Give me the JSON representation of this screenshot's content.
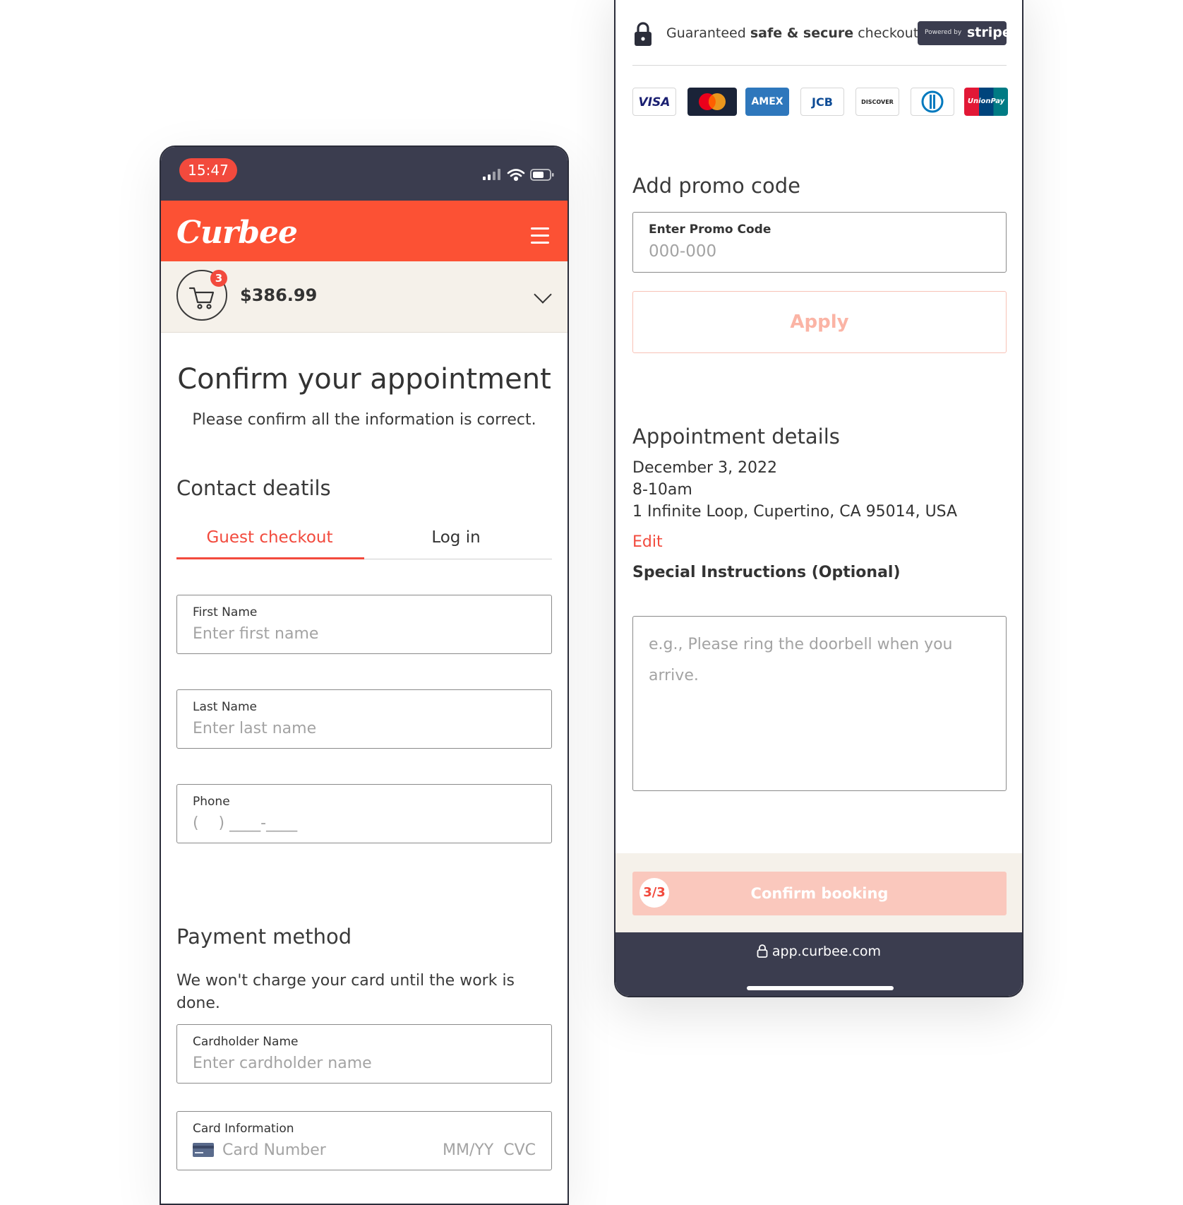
{
  "left_phone": {
    "status_time": "15:47",
    "brand": "Curbee",
    "cart": {
      "count": "3",
      "total": "$386.99"
    },
    "page_title": "Confirm your appointment",
    "page_subtitle": "Please confirm all the information is correct.",
    "contact_heading": "Contact deatils",
    "tabs": [
      {
        "label": "Guest checkout"
      },
      {
        "label": "Log in"
      }
    ],
    "first_name": {
      "label": "First Name",
      "placeholder": "Enter first name"
    },
    "last_name": {
      "label": "Last Name",
      "placeholder": "Enter last name"
    },
    "phone": {
      "label": "Phone",
      "placeholder": "(    ) ____-____"
    },
    "payment_heading": "Payment method",
    "payment_note": "We won't charge your card until the work is done.",
    "cardholder": {
      "label": "Cardholder Name",
      "placeholder": "Enter cardholder name"
    },
    "card_info": {
      "label": "Card Information",
      "placeholder": "Card Number",
      "expiry_cvc": "MM/YY  CVC"
    }
  },
  "right_phone": {
    "secure": {
      "prefix": "Guaranteed ",
      "bold": "safe & secure",
      "suffix": " checkout"
    },
    "stripe": {
      "powered": "Powered by",
      "brand": "stripe"
    },
    "card_logos": [
      "VISA",
      "AMEX",
      "JCB",
      "DISCOVER",
      "UnionPay"
    ],
    "promo_heading": "Add promo code",
    "promo_field": {
      "label": "Enter Promo Code",
      "placeholder": "000-000"
    },
    "apply_label": "Apply",
    "appointment_heading": "Appointment details",
    "appointment": {
      "date": "December 3, 2022",
      "time": "8-10am",
      "address": "1 Infinite Loop, Cupertino, CA 95014, USA"
    },
    "edit_label": "Edit",
    "instructions_label": "Special Instructions (Optional)",
    "instructions_placeholder": "e.g., Please ring the doorbell when you arrive.",
    "step": "3/3",
    "confirm_label": "Confirm booking",
    "url": "app.curbee.com"
  },
  "colors": {
    "accent": "#fc5134",
    "dark": "#3b3d4f",
    "cream": "#f5f1ea",
    "confirm_disabled": "#fac8bd"
  }
}
